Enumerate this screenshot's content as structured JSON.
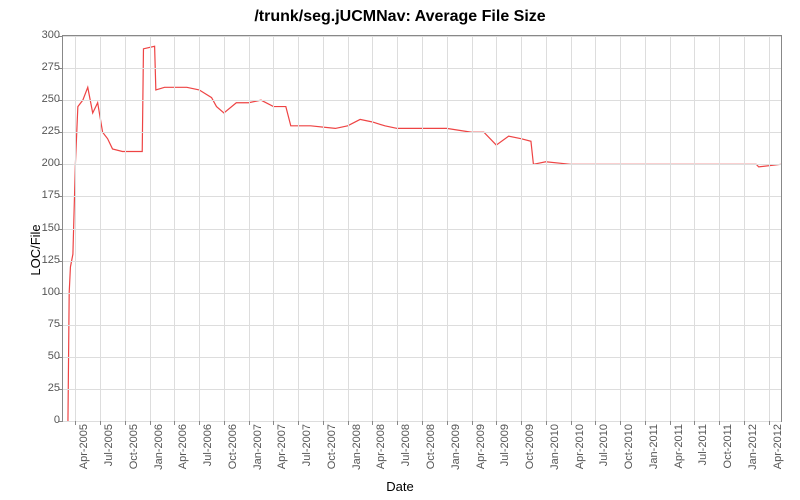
{
  "chart_data": {
    "type": "line",
    "title": "/trunk/seg.jUCMNav: Average File Size",
    "xlabel": "Date",
    "ylabel": "LOC/File",
    "ylim": [
      0,
      300
    ],
    "y_ticks": [
      0,
      25,
      50,
      75,
      100,
      125,
      150,
      175,
      200,
      225,
      250,
      275,
      300
    ],
    "x_categories": [
      "Apr-2005",
      "Jul-2005",
      "Oct-2005",
      "Jan-2006",
      "Apr-2006",
      "Jul-2006",
      "Oct-2006",
      "Jan-2007",
      "Apr-2007",
      "Jul-2007",
      "Oct-2007",
      "Jan-2008",
      "Apr-2008",
      "Jul-2008",
      "Oct-2008",
      "Jan-2009",
      "Apr-2009",
      "Jul-2009",
      "Oct-2009",
      "Jan-2010",
      "Apr-2010",
      "Jul-2010",
      "Oct-2010",
      "Jan-2011",
      "Apr-2011",
      "Jul-2011",
      "Oct-2011",
      "Jan-2012",
      "Apr-2012"
    ],
    "series": [
      {
        "name": "Average File Size",
        "points": [
          {
            "xi": -0.3,
            "y": 0
          },
          {
            "xi": -0.25,
            "y": 100
          },
          {
            "xi": -0.2,
            "y": 120
          },
          {
            "xi": -0.1,
            "y": 130
          },
          {
            "xi": 0.0,
            "y": 200
          },
          {
            "xi": 0.1,
            "y": 245
          },
          {
            "xi": 0.3,
            "y": 250
          },
          {
            "xi": 0.5,
            "y": 260
          },
          {
            "xi": 0.7,
            "y": 240
          },
          {
            "xi": 0.9,
            "y": 248
          },
          {
            "xi": 1.1,
            "y": 225
          },
          {
            "xi": 1.3,
            "y": 220
          },
          {
            "xi": 1.5,
            "y": 212
          },
          {
            "xi": 1.9,
            "y": 210
          },
          {
            "xi": 2.3,
            "y": 210
          },
          {
            "xi": 2.7,
            "y": 210
          },
          {
            "xi": 2.75,
            "y": 290
          },
          {
            "xi": 3.2,
            "y": 292
          },
          {
            "xi": 3.25,
            "y": 258
          },
          {
            "xi": 3.6,
            "y": 260
          },
          {
            "xi": 4.0,
            "y": 260
          },
          {
            "xi": 4.5,
            "y": 260
          },
          {
            "xi": 5.0,
            "y": 258
          },
          {
            "xi": 5.5,
            "y": 252
          },
          {
            "xi": 5.7,
            "y": 245
          },
          {
            "xi": 6.0,
            "y": 240
          },
          {
            "xi": 6.5,
            "y": 248
          },
          {
            "xi": 7.0,
            "y": 248
          },
          {
            "xi": 7.5,
            "y": 250
          },
          {
            "xi": 8.0,
            "y": 245
          },
          {
            "xi": 8.5,
            "y": 245
          },
          {
            "xi": 8.7,
            "y": 230
          },
          {
            "xi": 9.5,
            "y": 230
          },
          {
            "xi": 10.5,
            "y": 228
          },
          {
            "xi": 11.0,
            "y": 230
          },
          {
            "xi": 11.5,
            "y": 235
          },
          {
            "xi": 12.0,
            "y": 233
          },
          {
            "xi": 12.5,
            "y": 230
          },
          {
            "xi": 13.0,
            "y": 228
          },
          {
            "xi": 14.0,
            "y": 228
          },
          {
            "xi": 15.0,
            "y": 228
          },
          {
            "xi": 16.0,
            "y": 225
          },
          {
            "xi": 16.5,
            "y": 225
          },
          {
            "xi": 17.0,
            "y": 215
          },
          {
            "xi": 17.5,
            "y": 222
          },
          {
            "xi": 18.0,
            "y": 220
          },
          {
            "xi": 18.4,
            "y": 218
          },
          {
            "xi": 18.5,
            "y": 200
          },
          {
            "xi": 19.0,
            "y": 202
          },
          {
            "xi": 20.0,
            "y": 200
          },
          {
            "xi": 22.0,
            "y": 200
          },
          {
            "xi": 24.0,
            "y": 200
          },
          {
            "xi": 26.0,
            "y": 200
          },
          {
            "xi": 27.5,
            "y": 200
          },
          {
            "xi": 27.6,
            "y": 198
          },
          {
            "xi": 28.5,
            "y": 200
          }
        ]
      }
    ]
  }
}
